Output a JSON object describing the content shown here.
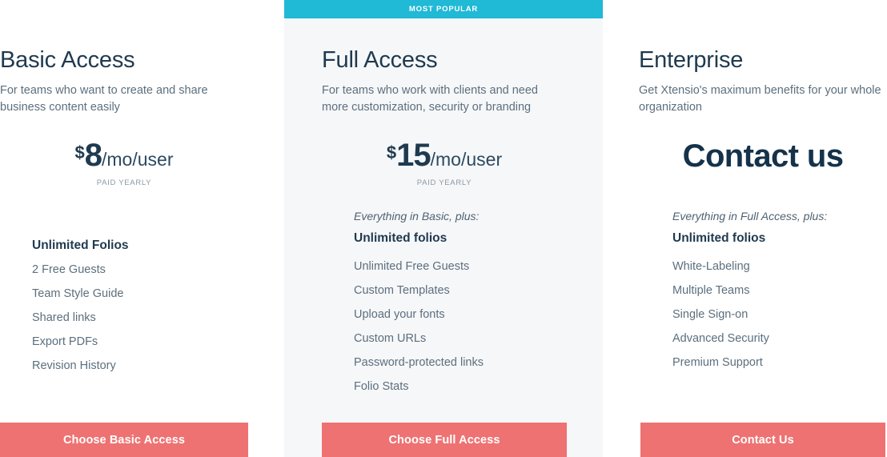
{
  "accent_colors": {
    "banner": "#20b9d6",
    "cta": "#ee7272",
    "heading": "#1f3a4f",
    "body_text": "#5c6f7e",
    "panel_bg": "#f6f7f9"
  },
  "plans": [
    {
      "id": "basic",
      "title": "Basic Access",
      "description": "For teams who want to create and share business content easily",
      "badge": "",
      "price": {
        "currency": "$",
        "amount": "8",
        "period": "/mo/user",
        "note": "PAID YEARLY"
      },
      "feature_intro": "",
      "features": [
        "Unlimited Folios",
        "2 Free Guests",
        "Team Style Guide",
        "Shared links",
        "Export PDFs",
        "Revision History"
      ],
      "cta_label": "Choose Basic Access"
    },
    {
      "id": "full",
      "title": "Full Access",
      "description": "For teams who work with clients and need more customization, security or branding",
      "badge": "MOST POPULAR",
      "price": {
        "currency": "$",
        "amount": "15",
        "period": "/mo/user",
        "note": "PAID YEARLY"
      },
      "feature_intro": "Everything in Basic, plus:",
      "features": [
        "Unlimited folios",
        "Unlimited Free Guests",
        "Custom Templates",
        "Upload your fonts",
        "Custom URLs",
        "Password-protected links",
        "Folio Stats"
      ],
      "cta_label": "Choose Full Access"
    },
    {
      "id": "enterprise",
      "title": "Enterprise",
      "description": "Get Xtensio's maximum benefits for your whole organization",
      "badge": "",
      "price": {
        "contact_text": "Contact us"
      },
      "feature_intro": "Everything in Full Access, plus:",
      "features": [
        "Unlimited folios",
        "White-Labeling",
        "Multiple Teams",
        "Single Sign-on",
        "Advanced Security",
        "Premium Support"
      ],
      "cta_label": "Contact Us"
    }
  ]
}
